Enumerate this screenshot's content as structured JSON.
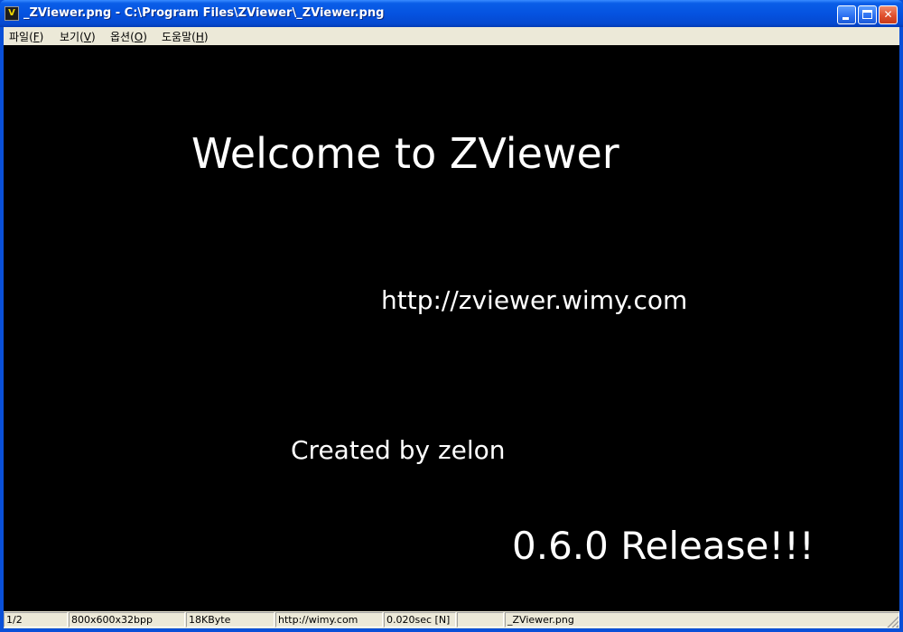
{
  "window": {
    "title": "_ZViewer.png - C:\\Program Files\\ZViewer\\_ZViewer.png",
    "icon_glyph": "V",
    "min_glyph": "",
    "max_glyph": "",
    "close_glyph": "✕"
  },
  "menu": {
    "items": [
      {
        "label": "파일(",
        "key": "F",
        "end": ")"
      },
      {
        "label": "보기(",
        "key": "V",
        "end": ")"
      },
      {
        "label": "옵션(",
        "key": "O",
        "end": ")"
      },
      {
        "label": "도움말(",
        "key": "H",
        "end": ")"
      }
    ]
  },
  "viewer": {
    "welcome": "Welcome to ZViewer",
    "url": "http://zviewer.wimy.com",
    "created": "Created by zelon",
    "release": "0.6.0 Release!!!"
  },
  "status": {
    "index": "1/2",
    "dimensions": "800x600x32bpp",
    "size": "18KByte",
    "site": "http://wimy.com",
    "time": "0.020sec [N]",
    "empty": "",
    "filename": "_ZViewer.png"
  },
  "colors": {
    "titlebar": "#0553e0",
    "viewer_bg": "#000000",
    "chrome": "#ece9d8",
    "close_btn": "#e0502e"
  }
}
